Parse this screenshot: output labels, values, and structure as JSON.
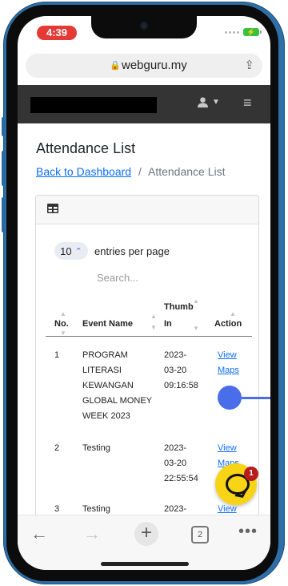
{
  "status_bar": {
    "time": "4:39",
    "battery_icon": "charging-bolt"
  },
  "browser": {
    "url": "webguru.my",
    "lock_icon": "lock",
    "share_icon": "share"
  },
  "site_header": {
    "user_icon": "user",
    "menu_icon": "hamburger"
  },
  "page": {
    "title": "Attendance List",
    "breadcrumb": {
      "back_label": "Back to Dashboard",
      "separator": "/",
      "current": "Attendance List"
    }
  },
  "table_controls": {
    "per_page_value": "10",
    "entries_label": "entries per page",
    "search_placeholder": "Search..."
  },
  "table": {
    "columns": {
      "no": "No.",
      "event": "Event Name",
      "thumb_line1": "Thumb",
      "thumb_line2": "In",
      "action": "Action"
    },
    "rows": [
      {
        "no": "1",
        "event_lines": [
          "PROGRAM",
          "LITERASI",
          "KEWANGAN",
          "GLOBAL MONEY",
          "WEEK 2023"
        ],
        "thumb_lines": [
          "2023-",
          "03-20",
          "09:16:58"
        ],
        "action_view": "View",
        "action_maps": "Maps"
      },
      {
        "no": "2",
        "event_lines": [
          "Testing"
        ],
        "thumb_lines": [
          "2023-",
          "03-20",
          "22:55:54"
        ],
        "action_view": "View",
        "action_maps": "Maps"
      },
      {
        "no": "3",
        "event_lines": [
          "Testing"
        ],
        "thumb_lines": [
          "2023-"
        ],
        "action_view": "View",
        "action_maps": ""
      }
    ]
  },
  "chat": {
    "badge_count": "1"
  },
  "bottom_bar": {
    "tab_count": "2"
  }
}
